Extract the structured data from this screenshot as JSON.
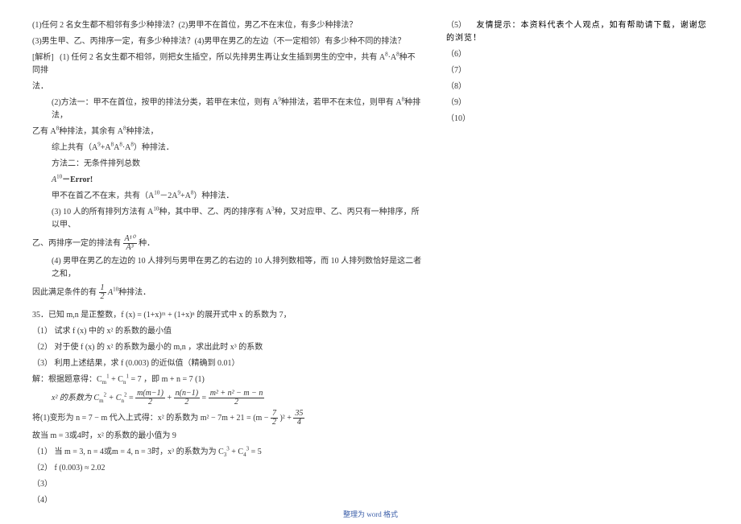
{
  "left": {
    "q1": "(1)任何 2 名女生都不相邻有多少种排法？(2)男甲不在首位，男乙不在末位，有多少种排法？",
    "q3": "(3)男生甲、乙、丙排序一定，有多少种排法？(4)男甲在男乙的左边（不一定相邻）有多少种不同的排法？",
    "ans_label": "[解析]",
    "a1": "(1) 任何 2 名女生都不相邻，则把女生插空，所以先排男生再让女生插到男生的空中，共有 A",
    "a1b": "种不同排",
    "a1c": "法．",
    "a2a": "(2)方法一：甲不在首位，按甲的排法分类，若甲在末位，则有 A",
    "a2b": "种排法，若甲不在末位，则甲有 A",
    "a2c": "种排法，",
    "a2d": "乙有 A",
    "a2e": "种排法，其余有 A",
    "a2f": "种排法，",
    "a2g": "综上共有（A",
    "a2h": "+A",
    "a2i": "A",
    "a2j": "·A",
    "a2k": "）种排法．",
    "m2a": "方法二：无条件排列总数",
    "m2b": "A",
    "m2c": "－Error!",
    "m2d": "甲不在首乙不在末，共有（A",
    "m2e": "－2A",
    "m2f": "+A",
    "m2g": "）种排法．",
    "a3a": "(3) 10 人的所有排列方法有 A",
    "a3b": "种，其中甲、乙、丙的排序有 A",
    "a3c": "种，又对应甲、乙、丙只有一种排序，所以甲、",
    "a3d": "乙、丙排序一定的排法有",
    "a3e": "种．",
    "a4a": "(4) 男甲在男乙的左边的 10 人排列与男甲在男乙的右边的 10 人排列数相等，而 10 人排列数恰好是这二者之和，",
    "a4b": "因此满足条件的有",
    "a4c": "A",
    "a4d": "种排法．",
    "p35": "35．已知 m,n 是正整数，f (x) = (1+x)ᵐ + (1+x)ⁿ 的展开式中 x 的系数为 7，",
    "p35_1": "（1） 试求 f (x) 中的 x² 的系数的最小值",
    "p35_2": "（2） 对于使 f (x) 的 x² 的系数为最小的 m,n ，求出此时 x³ 的系数",
    "p35_3": "（3） 利用上述结果，求 f (0.003) 的近似值（精确到 0.01）",
    "sol_a": "解：根据题意得：C",
    "sol_b": " + C",
    "sol_c": " = 7 ，即 m + n = 7    (1)",
    "sol_d": "x² 的系数为 C",
    "sol_e": " + C",
    "sol_f": " = ",
    "sol_g": " + ",
    "sol_h": " = ",
    "sol_i": "将(1)变形为 n = 7 − m 代入上式得：x² 的系数为 m² − 7m + 21 = (m − ",
    "sol_j": ")² + ",
    "sol_k": "故当 m = 3或4时，x² 的系数的最小值为 9",
    "sol_l": "（1）  当 m = 3, n = 4或m = 4, n = 3时，x³ 的系数为为 C",
    "sol_m": " + C",
    "sol_n": " = 5",
    "sol_o": "（2）  f (0.003) ≈ 2.02",
    "sol_p": "（3）",
    "sol_q": "（4）",
    "frac_m": "m(m−1)",
    "frac_n": "n(n−1)",
    "frac_2": "2",
    "frac_sum": "m² + n² − m − n",
    "frac_72": "7",
    "frac_354": "35",
    "frac_4": "4",
    "frac_a10": "A¹⁰",
    "frac_a3": "A³",
    "frac_12": "1"
  },
  "right": {
    "n5": "（5）",
    "hint": "友情提示：本资料代表个人观点，如有帮助请下载，谢谢您的浏览！",
    "n6": "（6）",
    "n7": "（7）",
    "n8": "（8）",
    "n9": "（9）",
    "n10": "（10）"
  },
  "footer": "整理为 word 格式"
}
